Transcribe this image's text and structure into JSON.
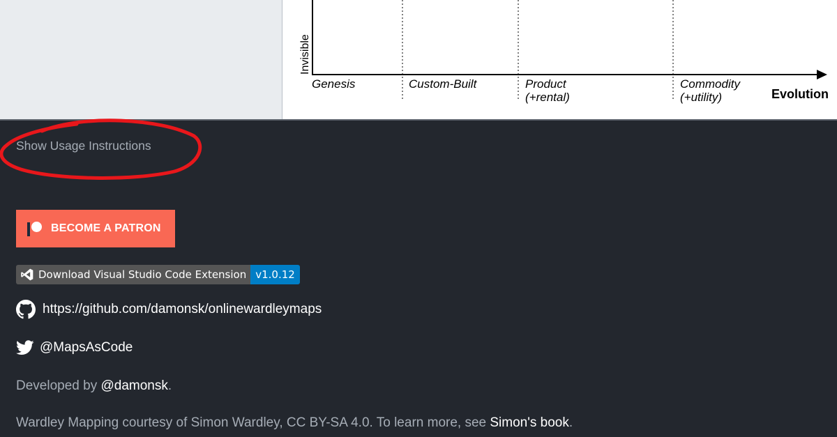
{
  "map": {
    "y_axis_label": "Invisible",
    "x_axis_label": "Evolution",
    "stages": [
      {
        "line1": "Genesis",
        "line2": ""
      },
      {
        "line1": "Custom-Built",
        "line2": ""
      },
      {
        "line1": "Product",
        "line2": "(+rental)"
      },
      {
        "line1": "Commodity",
        "line2": "(+utility)"
      }
    ]
  },
  "footer": {
    "usage_link": "Show Usage Instructions",
    "patron_button": "BECOME A PATRON",
    "vscode_badge": {
      "label": "Download Visual Studio Code Extension",
      "version": "v1.0.12"
    },
    "github_url": "https://github.com/damonsk/onlinewardleymaps",
    "twitter_handle": "@MapsAsCode",
    "developed_prefix": "Developed by ",
    "developer_link": "@damonsk",
    "developed_suffix": ".",
    "credit_text": "Wardley Mapping courtesy of Simon Wardley, CC BY-SA 4.0. To learn more, see ",
    "credit_link": "Simon's book",
    "credit_suffix": "."
  },
  "colors": {
    "background": "#23272e",
    "patron": "#f96854",
    "badge_left": "#555555",
    "badge_right": "#007ec6",
    "annotation": "#e8171b",
    "muted_text": "#a6adb6"
  },
  "icons": [
    "patreon-icon",
    "vscode-icon",
    "github-icon",
    "twitter-icon"
  ]
}
